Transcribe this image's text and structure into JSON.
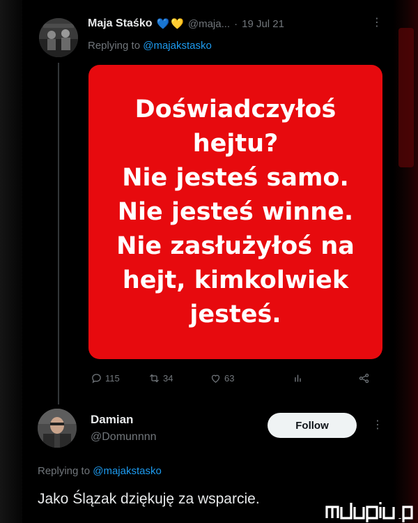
{
  "tweet1": {
    "name": "Maja Staśko",
    "emoji_hearts": [
      "💙",
      "💛"
    ],
    "handle": "@maja...",
    "separator": "·",
    "date": "19 Jul 21",
    "more_icon": "more-vertical-icon",
    "reply_prefix": "Replying to",
    "reply_mention": "@majakstasko",
    "graphic": {
      "background": "#e70a0e",
      "lines": [
        "Doświadczyłoś",
        "hejtu?",
        "Nie jesteś samo.",
        "Nie jesteś winne.",
        "Nie zasłużyłoś na",
        "hejt, kimkolwiek",
        "jesteś."
      ]
    },
    "actions": {
      "replies": "115",
      "retweets": "34",
      "likes": "63",
      "icons": [
        "reply-icon",
        "retweet-icon",
        "like-icon",
        "views-icon",
        "share-icon"
      ]
    }
  },
  "tweet2": {
    "name": "Damian",
    "handle": "@Domunnnn",
    "follow_label": "Follow",
    "more_icon": "more-vertical-icon",
    "reply_prefix": "Replying to",
    "reply_mention": "@majakstasko",
    "body": "Jako Ślązak dziękuję za wsparcie."
  },
  "colors": {
    "background": "#000000",
    "text": "#e7e9ea",
    "secondary": "#71767b",
    "link": "#1d9bf0",
    "graphic_red": "#e70a0e",
    "button": "#eff3f4"
  },
  "watermark": {
    "text": "mdupiu.pl"
  }
}
